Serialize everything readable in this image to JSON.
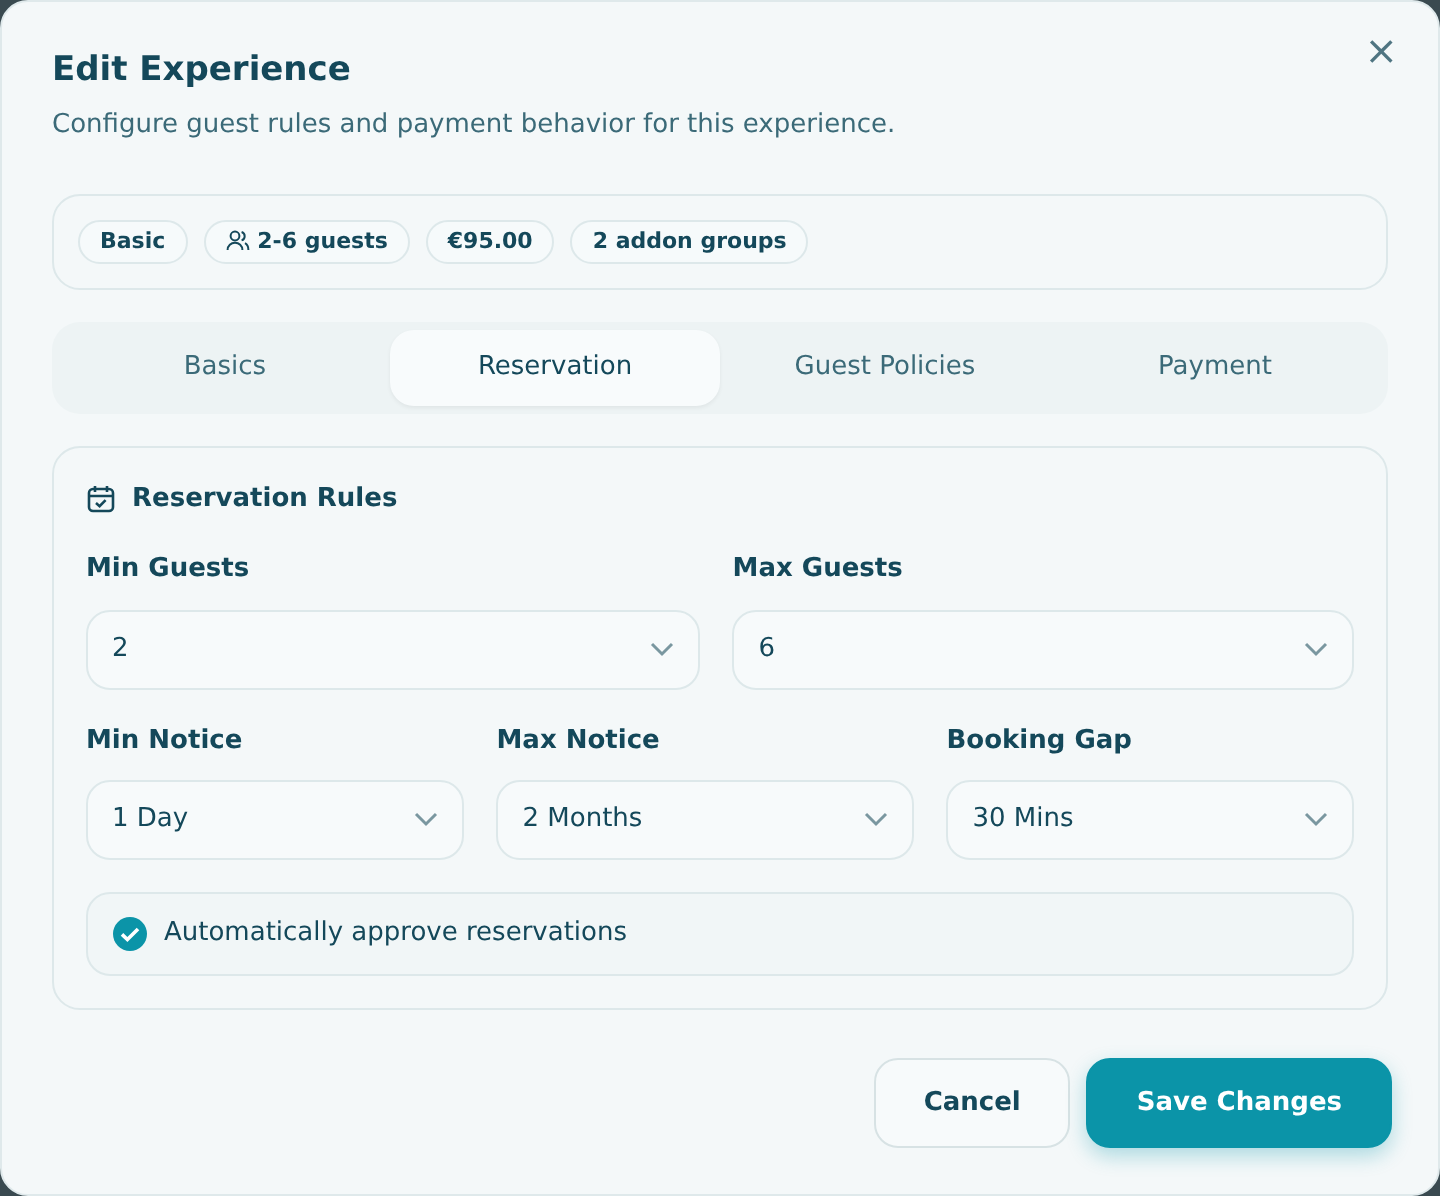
{
  "dialog": {
    "title": "Edit Experience",
    "subtitle": "Configure guest rules and payment behavior for this experience.",
    "close": "×"
  },
  "chips": [
    {
      "label": "Basic",
      "kind": "plain"
    },
    {
      "label": "2-6 guests",
      "kind": "guests"
    },
    {
      "label": "€95.00",
      "kind": "plain"
    },
    {
      "label": "2 addon groups",
      "kind": "plain"
    }
  ],
  "tabs": [
    {
      "label": "Basics",
      "selected": false
    },
    {
      "label": "Reservation",
      "selected": true
    },
    {
      "label": "Guest Policies",
      "selected": false
    },
    {
      "label": "Payment",
      "selected": false
    }
  ],
  "section": {
    "title": "Reservation Rules",
    "field_rows": [
      [
        {
          "label": "Min Guests",
          "value": "2"
        },
        {
          "label": "Max Guests",
          "value": "6"
        }
      ],
      [
        {
          "label": "Min Notice",
          "value": "1 Day"
        },
        {
          "label": "Max Notice",
          "value": "2 Months"
        },
        {
          "label": "Booking Gap",
          "value": "30 Mins"
        }
      ]
    ],
    "checkbox": {
      "label": "Automatically approve reservations",
      "checked": true
    }
  },
  "buttons": [
    {
      "label": "Cancel",
      "kind": "secondary"
    },
    {
      "label": "Save Changes",
      "kind": "primary"
    }
  ]
}
